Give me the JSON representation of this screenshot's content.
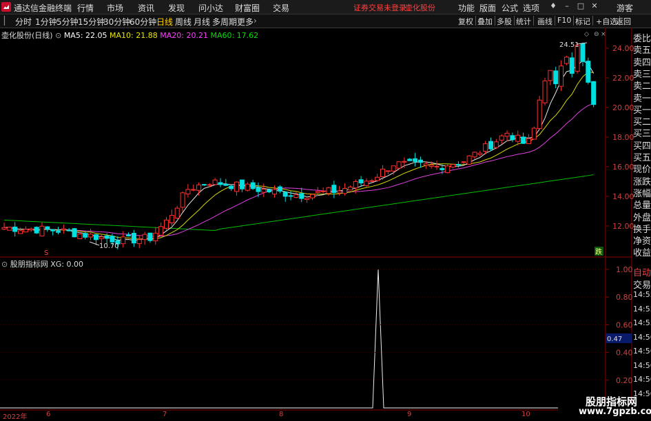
{
  "menubar": {
    "app_title": "通达信金融终端",
    "items": [
      "行情",
      "市场",
      "资讯",
      "发现",
      "问小达",
      "财富圈",
      "交易"
    ],
    "notice": "证券交易未登录",
    "stock_name": "壶化股份",
    "right_items": [
      "功能",
      "版面",
      "公式",
      "选项"
    ],
    "user": "游客"
  },
  "periods": {
    "tabs": [
      "分时",
      "1分钟",
      "5分钟",
      "15分钟",
      "30分钟",
      "60分钟",
      "日线",
      "周线",
      "月线",
      "多周期",
      "更多"
    ],
    "active": "日线",
    "tools": [
      "复权",
      "叠加",
      "多股",
      "统计",
      "画线",
      "F10",
      "标记",
      "+自选",
      "返回"
    ]
  },
  "main_chart": {
    "title": "壶化股份(日线)",
    "ma": [
      {
        "label": "MA5: 22.05",
        "color": "#ffffff"
      },
      {
        "label": "MA10: 21.88",
        "color": "#e8e800"
      },
      {
        "label": "MA20: 20.21",
        "color": "#ff40ff"
      },
      {
        "label": "MA60: 17.62",
        "color": "#00e000"
      }
    ],
    "high_label": "24.51",
    "low_label": "10.70",
    "y_ticks": [
      "24.00",
      "22.00",
      "20.00",
      "18.00",
      "16.00",
      "14.00",
      "12.00"
    ],
    "marker_s": "S",
    "marker_die": "跌"
  },
  "indicator": {
    "title": "股朋指标网",
    "value_label": "XG: 0.00",
    "y_ticks": [
      "1.00",
      "0.80",
      "0.60",
      "0.40",
      "0.20"
    ],
    "current": "0.47"
  },
  "right_panel": {
    "quote_rows": [
      "委比",
      "卖五",
      "卖四",
      "卖三",
      "卖二",
      "卖一",
      "买一",
      "买二",
      "买三",
      "买四",
      "买五",
      "现价",
      "涨跌",
      "涨幅",
      "总量",
      "外盘",
      "换手",
      "净资",
      "收益"
    ],
    "lower_rows": [
      "自动",
      "交易"
    ],
    "times": [
      "14:55",
      "14:55",
      "14:55",
      "14:56",
      "14:56",
      "14:56",
      "14:56",
      "14:56"
    ]
  },
  "x_axis": {
    "labels": [
      "2022年",
      "6",
      "7",
      "8",
      "9",
      "10"
    ]
  },
  "watermark": {
    "line1": "股朋指标网",
    "line2": "www.7gpzb.com"
  },
  "chart_data": {
    "type": "candlestick",
    "title": "壶化股份(日线)",
    "ylim": [
      10,
      25
    ],
    "ma_values": {
      "MA5": 22.05,
      "MA10": 21.88,
      "MA20": 20.21,
      "MA60": 17.62
    },
    "annotations": {
      "high": 24.51,
      "low": 10.7
    }
  }
}
